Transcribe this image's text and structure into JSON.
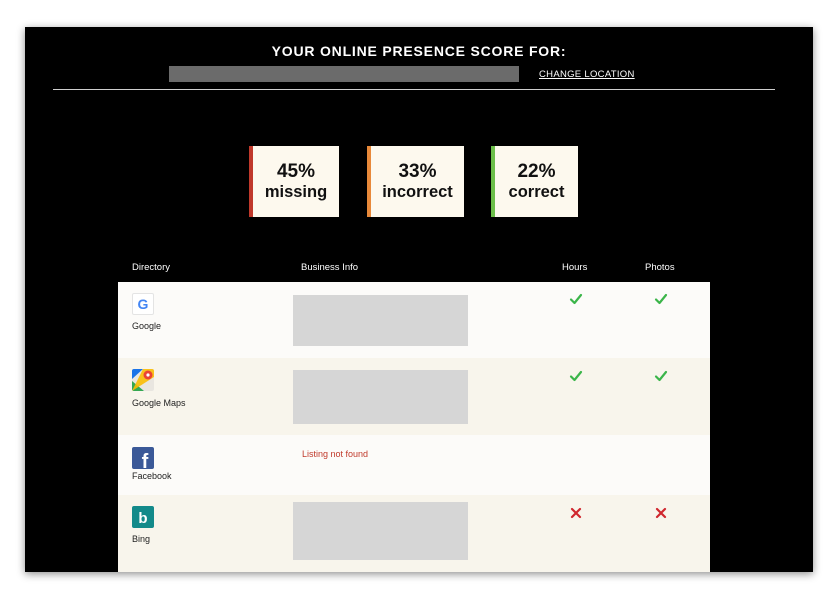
{
  "header": {
    "title": "YOUR ONLINE PRESENCE SCORE FOR:",
    "change_location": "CHANGE LOCATION"
  },
  "scores": [
    {
      "percent": "45%",
      "label": "missing",
      "color": "#c0392b"
    },
    {
      "percent": "33%",
      "label": "incorrect",
      "color": "#e8893a"
    },
    {
      "percent": "22%",
      "label": "correct",
      "color": "#6cbf4a"
    }
  ],
  "table": {
    "headers": {
      "directory": "Directory",
      "business_info": "Business Info",
      "hours": "Hours",
      "photos": "Photos"
    },
    "rows": [
      {
        "name": "Google",
        "icon": "google-icon",
        "business_info": null,
        "hours": "check",
        "photos": "check"
      },
      {
        "name": "Google Maps",
        "icon": "google-maps-icon",
        "business_info": null,
        "hours": "check",
        "photos": "check"
      },
      {
        "name": "Facebook",
        "icon": "facebook-icon",
        "business_info": "Listing not found",
        "hours": null,
        "photos": null
      },
      {
        "name": "Bing",
        "icon": "bing-icon",
        "business_info": null,
        "hours": "cross",
        "photos": "cross"
      }
    ]
  },
  "colors": {
    "page_background": "#000000",
    "row_light": "#fcfbf9",
    "row_tinted": "#f8f5ec",
    "check": "#3bb54a",
    "cross": "#d0272e",
    "not_found_text": "#c0392b"
  }
}
